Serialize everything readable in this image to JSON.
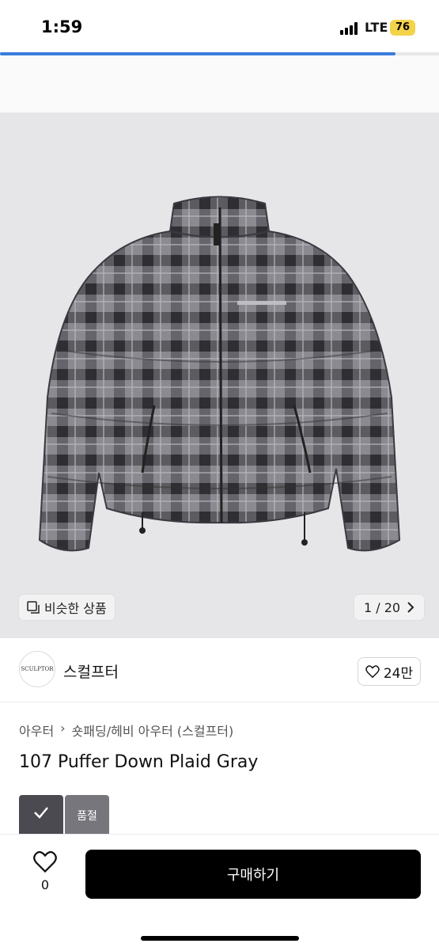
{
  "status_bar": {
    "time": "1:59",
    "network": "LTE",
    "battery": "76"
  },
  "load_progress": 0.9,
  "image_gallery": {
    "similar_label": "비슷한 상품",
    "counter": "1 / 20"
  },
  "store": {
    "logo_text": "SCULPTOR",
    "name": "스컬프터",
    "likes": "24만"
  },
  "breadcrumb": [
    "아우터",
    "숏패딩/헤비 아우터 (스컬프터)"
  ],
  "product": {
    "title": "107 Puffer Down Plaid Gray"
  },
  "options": [
    {
      "state": "selected"
    },
    {
      "label": "품절"
    }
  ],
  "bottom": {
    "wish_count": "0",
    "buy_label": "구매하기"
  }
}
